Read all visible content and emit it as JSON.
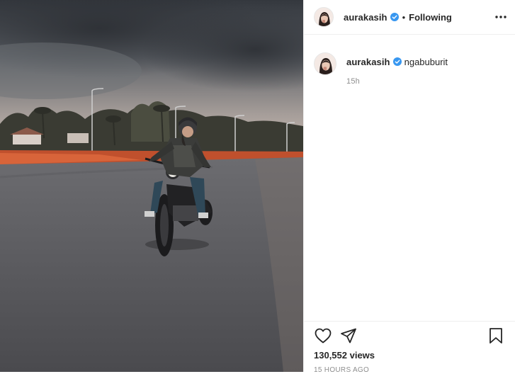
{
  "post": {
    "media_description": "motorcycle rider on road",
    "header": {
      "username": "aurakasih",
      "separator": "•",
      "follow_status": "Following"
    },
    "caption": {
      "username": "aurakasih",
      "text": "ngabuburit",
      "time": "15h"
    },
    "footer": {
      "views": "130,552 views",
      "posted_ago": "15 HOURS AGO"
    }
  },
  "icons": {
    "verified": "verified-badge-icon",
    "more": "more-options-icon",
    "like": "heart-icon",
    "share": "send-icon",
    "save": "bookmark-icon"
  },
  "colors": {
    "verified": "#3897f0",
    "text": "#262626",
    "muted": "#8e8e8e",
    "border": "#efefef"
  }
}
